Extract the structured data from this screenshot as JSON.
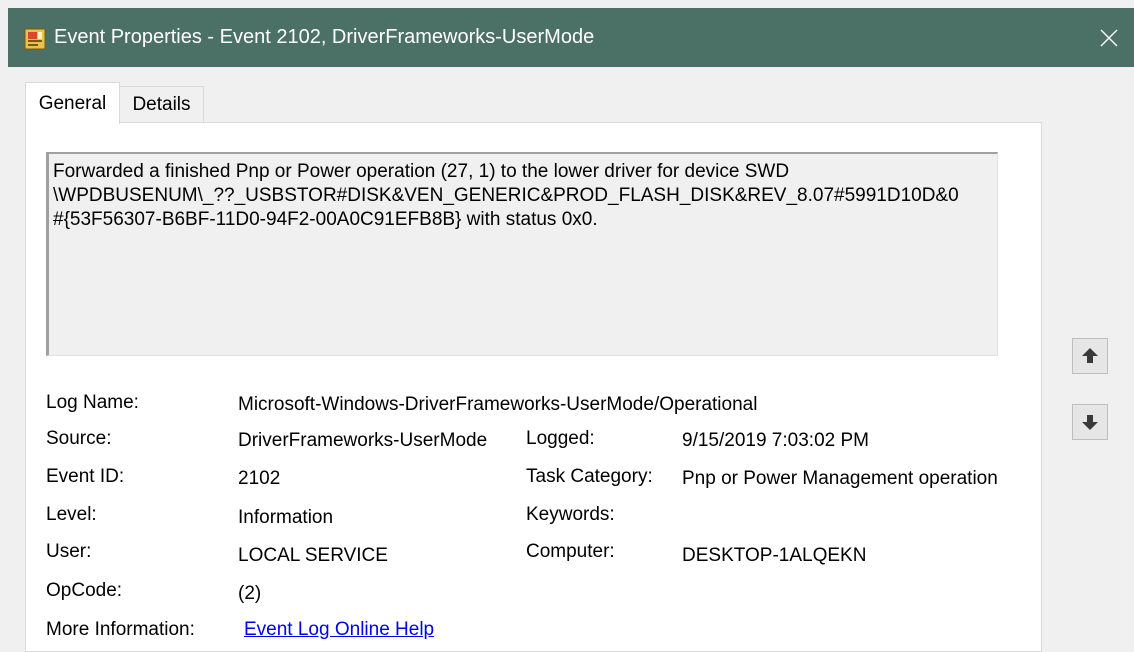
{
  "window": {
    "title": "Event Properties - Event 2102, DriverFrameworks-UserMode",
    "close_glyph": "✕"
  },
  "tabs": [
    {
      "label": "General",
      "active": true
    },
    {
      "label": "Details",
      "active": false
    }
  ],
  "description": {
    "line1": "Forwarded a finished Pnp or Power operation (27, 1) to the lower driver for device SWD",
    "line2": "\\WPDBUSENUM\\_??_USBSTOR#DISK&VEN_GENERIC&PROD_FLASH_DISK&REV_8.07#5991D10D&0",
    "line3": "#{53F56307-B6BF-11D0-94F2-00A0C91EFB8B} with status 0x0."
  },
  "fields": {
    "log_name": {
      "label": "Log Name:",
      "value": "Microsoft-Windows-DriverFrameworks-UserMode/Operational"
    },
    "source": {
      "label": "Source:",
      "value": "DriverFrameworks-UserMode"
    },
    "logged": {
      "label": "Logged:",
      "value": "9/15/2019 7:03:02 PM"
    },
    "event_id": {
      "label": "Event ID:",
      "value": "2102"
    },
    "task_category": {
      "label": "Task Category:",
      "value": "Pnp or Power Management operation"
    },
    "level": {
      "label": "Level:",
      "value": "Information"
    },
    "keywords": {
      "label": "Keywords:",
      "value": ""
    },
    "user": {
      "label": "User:",
      "value": "LOCAL SERVICE"
    },
    "computer": {
      "label": "Computer:",
      "value": "DESKTOP-1ALQEKN"
    },
    "opcode": {
      "label": "OpCode:",
      "value": "(2)"
    },
    "more_info": {
      "label": "More Information:",
      "link": "Event Log Online Help"
    }
  },
  "nav": {
    "up_icon": "arrow-up-icon",
    "down_icon": "arrow-down-icon"
  },
  "colors": {
    "titlebar": "#4b7066",
    "link": "#0000ee"
  }
}
